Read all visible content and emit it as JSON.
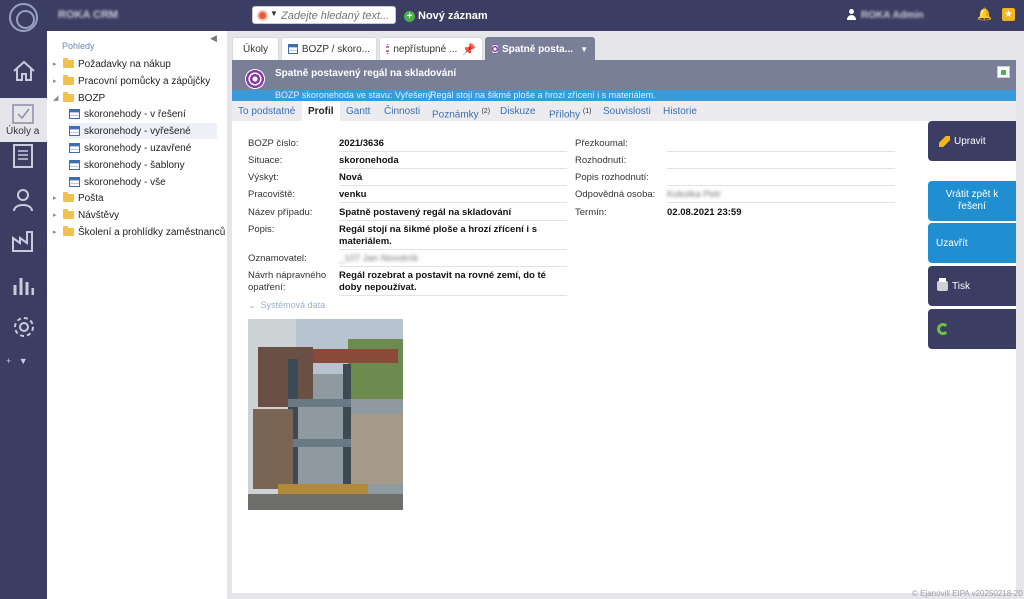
{
  "app": {
    "title": "ROKA CRM",
    "user": "ROKA Admin"
  },
  "topbar": {
    "search_placeholder": "Zadejte hledaný text...",
    "new_record_label": "Nový záznam"
  },
  "rail": {
    "active_label": "Úkoly a"
  },
  "tree": {
    "header": "Pohledy",
    "items": [
      {
        "label": "Požadavky na nákup"
      },
      {
        "label": "Pracovní pomůcky a zápůjčky"
      },
      {
        "label": "BOZP"
      },
      {
        "label": "skoronehody - v řešení"
      },
      {
        "label": "skoronehody - vyřešené"
      },
      {
        "label": "skoronehody - uzavřené"
      },
      {
        "label": "skoronehody - šablony"
      },
      {
        "label": "skoronehody - vše"
      },
      {
        "label": "Pošta"
      },
      {
        "label": "Návštěvy"
      },
      {
        "label": "Školení a prohlídky zaměstnanců"
      }
    ]
  },
  "tabs": [
    {
      "label": "Úkoly"
    },
    {
      "label": "BOZP / skoro..."
    },
    {
      "label": "nepřístupné ..."
    },
    {
      "label": "Spatně posta..."
    }
  ],
  "record": {
    "title": "Spatně postavený regál na skladování",
    "status": "BOZP skoronehoda ve stavu: Vyřešený",
    "status_desc": "Regál stojí na šikmé ploše a hrozí zřícení i s materiálem."
  },
  "subtabs": [
    {
      "label": "To podstatné"
    },
    {
      "label": "Profil"
    },
    {
      "label": "Gantt"
    },
    {
      "label": "Činnosti"
    },
    {
      "label": "Poznámky",
      "count": "(2)"
    },
    {
      "label": "Diskuze"
    },
    {
      "label": "Přílohy",
      "count": "(1)"
    },
    {
      "label": "Souvislosti"
    },
    {
      "label": "Historie"
    }
  ],
  "fields_left": [
    {
      "label": "BOZP číslo:",
      "value": "2021/3636"
    },
    {
      "label": "Situace:",
      "value": "skoronehoda"
    },
    {
      "label": "Výskyt:",
      "value": "Nová"
    },
    {
      "label": "Pracoviště:",
      "value": "venku"
    },
    {
      "label": "Název případu:",
      "value": "Spatně postavený regál na skladování"
    },
    {
      "label": "Popis:",
      "value": "Regál stojí na šikmé ploše a hrozí zřícení i s materiálem."
    },
    {
      "label": "Oznamovatel:",
      "value": "_107 Jan Novotník"
    },
    {
      "label": "Návrh nápravného opatření:",
      "value": "Regál rozebrat a postavit na rovné zemí, do té doby nepoužívat."
    }
  ],
  "fields_right": [
    {
      "label": "Přezkoumal:",
      "value": ""
    },
    {
      "label": "Rozhodnutí:",
      "value": ""
    },
    {
      "label": "Popis rozhodnutí:",
      "value": ""
    },
    {
      "label": "Odpovědná osoba:",
      "value": "Kokolka Petr"
    },
    {
      "label": "Termín:",
      "value": "02.08.2021 23:59"
    }
  ],
  "system_data_label": "Systémová data",
  "actions": [
    {
      "label": "Upravit"
    },
    {
      "label": "Vrátit zpět k řešení"
    },
    {
      "label": "Uzavřít"
    },
    {
      "label": "Tisk"
    }
  ],
  "footer": "© Ejanovill EIPA v20250218-20",
  "colors": {
    "topbar": "#3b3e62",
    "accent_blue": "#1f8fd1",
    "record_header": "#7a7f98",
    "status_bar": "#3a9ad9"
  }
}
